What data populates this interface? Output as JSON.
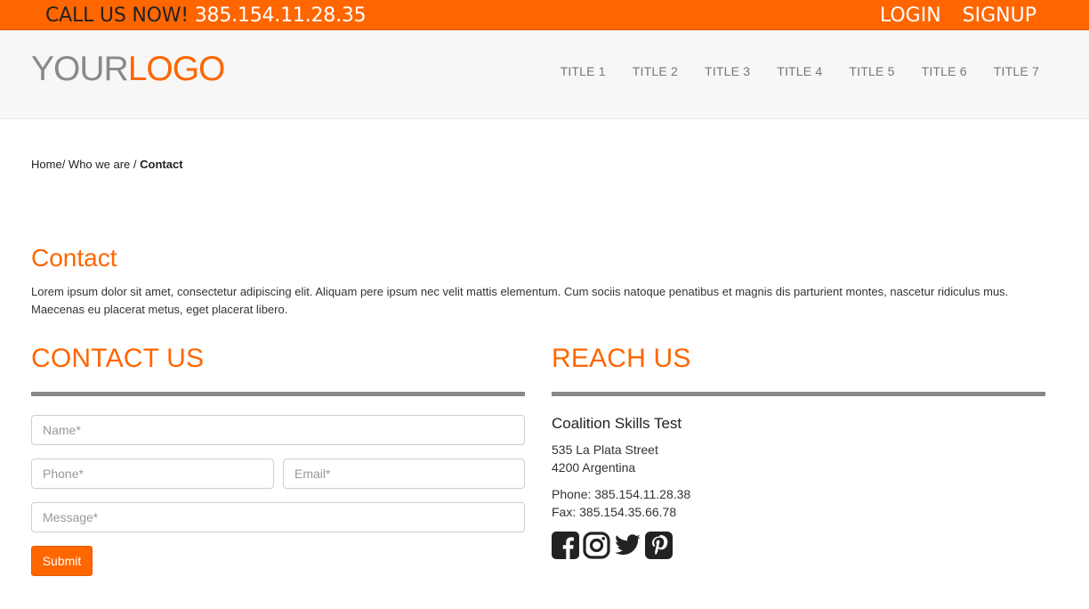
{
  "topbar": {
    "call_label": "CALL US NOW!",
    "phone": "385.154.11.28.35",
    "login": "LOGIN",
    "signup": "SIGNUP"
  },
  "header": {
    "logo_part1": "YOUR",
    "logo_part2": "LOGO",
    "nav": [
      "TITLE 1",
      "TITLE 2",
      "TITLE 3",
      "TITLE 4",
      "TITLE 5",
      "TITLE 6",
      "TITLE 7"
    ]
  },
  "breadcrumb": {
    "home": "Home",
    "sep1": "/ ",
    "who": "Who we are",
    "sep2": " / ",
    "current": "Contact"
  },
  "main": {
    "title": "Contact",
    "intro": "Lorem ipsum dolor sit amet, consectetur adipiscing elit. Aliquam pere ipsum nec velit mattis elementum. Cum sociis natoque penatibus et magnis dis parturient montes, nascetur ridiculus mus. Maecenas eu placerat metus, eget placerat libero."
  },
  "contact_form": {
    "title": "CONTACT US",
    "name_placeholder": "Name*",
    "phone_placeholder": "Phone*",
    "email_placeholder": "Email*",
    "message_placeholder": "Message*",
    "submit": "Submit"
  },
  "reach": {
    "title": "REACH US",
    "org": "Coalition Skills Test",
    "street": "535 La Plata Street",
    "city": "4200 Argentina",
    "phone": "Phone: 385.154.11.28.38",
    "fax": "Fax: 385.154.35.66.78",
    "social_icons": [
      "facebook-icon",
      "instagram-icon",
      "twitter-icon",
      "pinterest-icon"
    ]
  },
  "colors": {
    "accent": "#ff6600",
    "header_bg": "#f7f7f7",
    "rule": "#888888"
  }
}
